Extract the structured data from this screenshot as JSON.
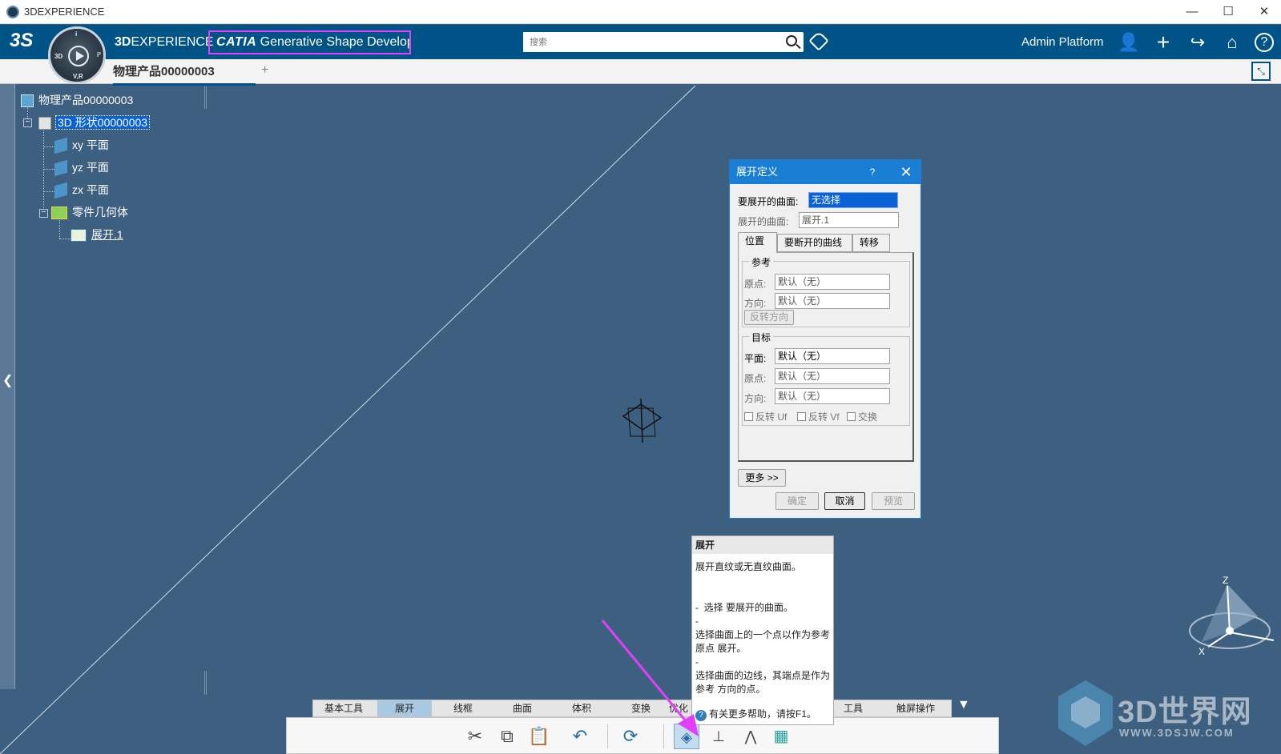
{
  "window": {
    "title": "3DEXPERIENCE"
  },
  "topbar": {
    "brand_bold": "3D",
    "brand_rest": "EXPERIENCE",
    "app_prefix": "CATIA",
    "app_name": "Generative Shape Develop",
    "search_placeholder": "搜索",
    "user": "Admin Platform",
    "compass_labels": {
      "top": "i",
      "left": "3D",
      "right": "i²",
      "bottom": "V,R"
    }
  },
  "tabs": {
    "current": "物理产品00000003",
    "add": "+"
  },
  "tree": {
    "root": "物理产品00000003",
    "shape": "3D 形状00000003",
    "children": [
      "xy 平面",
      "yz 平面",
      "zx 平面"
    ],
    "body": "零件几何体",
    "feature": "展开.1"
  },
  "dialog": {
    "title": "展开定义",
    "help": "?",
    "close": "✕",
    "surface_to_unfold_label": "要展开的曲面:",
    "surface_to_unfold_value": "无选择",
    "unfolded_surface_label": "展开的曲面:",
    "unfolded_surface_value": "展开.1",
    "tabs": [
      "位置",
      "要断开的曲线",
      "转移"
    ],
    "reference_group": "参考",
    "origin_label": "原点:",
    "direction_label": "方向:",
    "origin_value": "默认（无）",
    "direction_value": "默认（无）",
    "reverse_direction": "反转方向",
    "target_group": "目标",
    "plane_label": "平面:",
    "plane_value": "默认（无）",
    "target_origin_value": "默认（无）",
    "target_direction_value": "默认（无）",
    "checks": [
      "反转 Uf",
      "反转 Vf",
      "交换"
    ],
    "more": "更多 >>",
    "ok": "确定",
    "cancel": "取消",
    "preview": "预览"
  },
  "tooltip": {
    "title": "展开",
    "body": "展开直纹或无直纹曲面。\n\n\n-  选择 要展开的曲面。\n-\n选择曲面上的一个点以作为参考原点 展开。\n-\n选择曲面的边线，其端点是作为参考 方向的点。",
    "footer": "有关更多帮助，请按F1。"
  },
  "toolbar": {
    "tabs": [
      "基本工具",
      "展开",
      "线框",
      "曲面",
      "体积",
      "变换",
      "优化",
      "",
      "",
      "工具",
      "触屏操作"
    ],
    "active_tab": "展开"
  },
  "axis": {
    "z": "Z",
    "x": "X"
  },
  "watermark": {
    "big": "3D世界网",
    "small": "WWW.3DSJW.COM"
  },
  "colors": {
    "topbar": "#005386",
    "viewport": "#3d5f80",
    "highlight": "#e040fb",
    "dialog_title": "#1a7fd4"
  }
}
